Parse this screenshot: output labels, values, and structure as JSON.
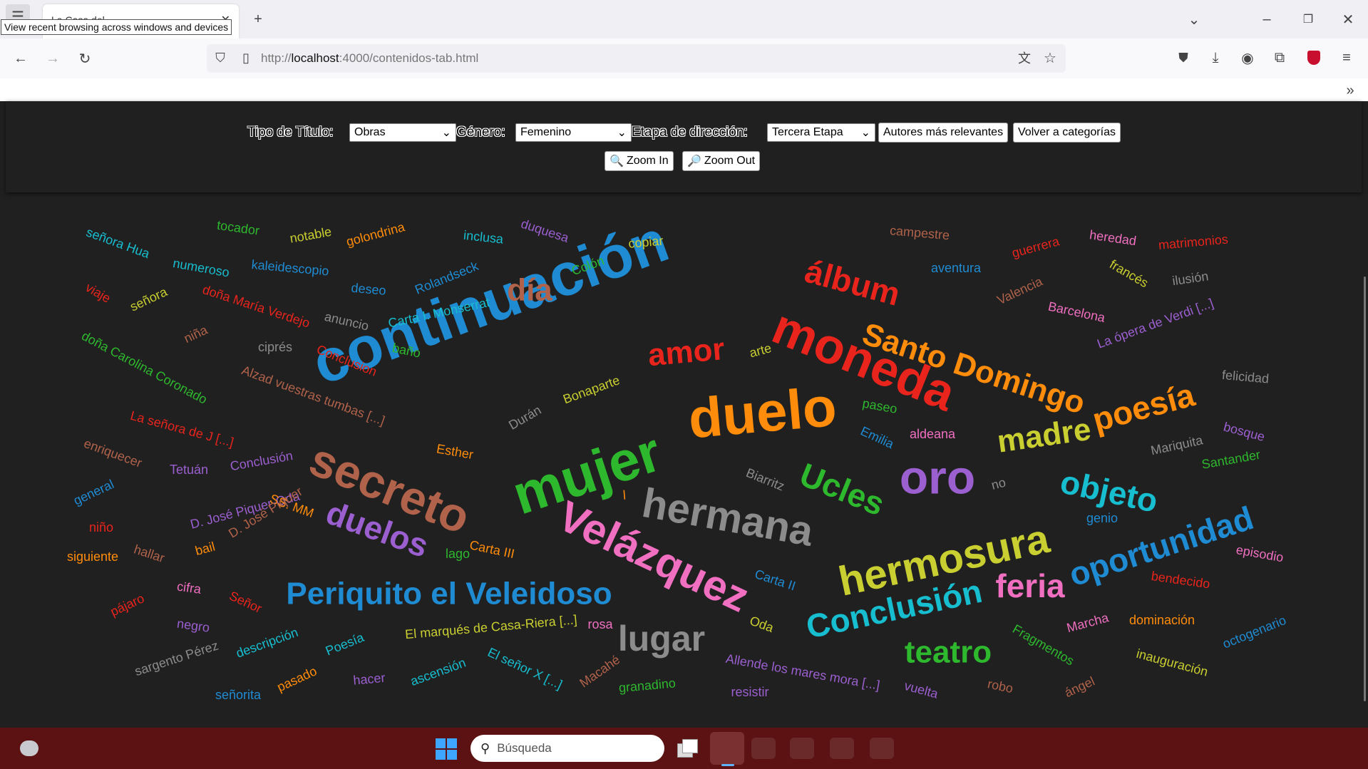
{
  "browser": {
    "tooltip": "View recent browsing across windows and devices",
    "url_prefix": "http://",
    "url_host": "localhost",
    "url_rest": ":4000/contenidos-tab.html",
    "tab_title": "La Casa del..."
  },
  "controls": {
    "tipo_label": "Tipo de Título:",
    "tipo_value": "Obras",
    "genero_label": "Género:",
    "genero_value": "Femenino",
    "etapa_label": "Etapa de dirección:",
    "etapa_value": "Tercera Etapa",
    "autores_button": "Autores más relevantes",
    "volver_button": "Volver a categorías",
    "zoom_in": "Zoom In",
    "zoom_out": "Zoom Out"
  },
  "taskbar": {
    "search_placeholder": "Búsqueda"
  },
  "word_cloud": [
    {
      "text": "continuación",
      "color": "#1f8bd2",
      "size": 84
    },
    {
      "text": "moneda",
      "color": "#e8241c",
      "size": 70
    },
    {
      "text": "duelo",
      "color": "#ff8c0a",
      "size": 78
    },
    {
      "text": "mujer",
      "color": "#2eb82e",
      "size": 78
    },
    {
      "text": "secreto",
      "color": "#b0624a",
      "size": 66
    },
    {
      "text": "Velázquez",
      "color": "#f06fc0",
      "size": 60
    },
    {
      "text": "hermana",
      "color": "#8c8c8c",
      "size": 58
    },
    {
      "text": "hermosura",
      "color": "#c9cf30",
      "size": 58
    },
    {
      "text": "oro",
      "color": "#9b5fd0",
      "size": 66
    },
    {
      "text": "Santo Domingo",
      "color": "#ff8c0a",
      "size": 44
    },
    {
      "text": "álbum",
      "color": "#e8241c",
      "size": 46
    },
    {
      "text": "amor",
      "color": "#e8241c",
      "size": 44
    },
    {
      "text": "día",
      "color": "#b0624a",
      "size": 44
    },
    {
      "text": "madre",
      "color": "#c9cf30",
      "size": 44
    },
    {
      "text": "poesía",
      "color": "#ff8c0a",
      "size": 46
    },
    {
      "text": "objeto",
      "color": "#17becf",
      "size": 46
    },
    {
      "text": "oportunidad",
      "color": "#1f8bd2",
      "size": 46
    },
    {
      "text": "Ucles",
      "color": "#2eb82e",
      "size": 46
    },
    {
      "text": "duelos",
      "color": "#9b5fd0",
      "size": 46
    },
    {
      "text": "Periquito el Veleidoso",
      "color": "#1f8bd2",
      "size": 44
    },
    {
      "text": "Conclusión",
      "color": "#17becf",
      "size": 46
    },
    {
      "text": "feria",
      "color": "#f06fc0",
      "size": 46
    },
    {
      "text": "teatro",
      "color": "#2eb82e",
      "size": 44
    },
    {
      "text": "lugar",
      "color": "#8c8c8c",
      "size": 50
    },
    {
      "text": "señora Hua",
      "color": "#17becf",
      "size": 18
    },
    {
      "text": "tocador",
      "color": "#2eb82e",
      "size": 18
    },
    {
      "text": "notable",
      "color": "#c9cf30",
      "size": 18
    },
    {
      "text": "golondrina",
      "color": "#ff8c0a",
      "size": 18
    },
    {
      "text": "inclusa",
      "color": "#17becf",
      "size": 18
    },
    {
      "text": "duquesa",
      "color": "#9b5fd0",
      "size": 18
    },
    {
      "text": "copiar",
      "color": "#c9cf30",
      "size": 18
    },
    {
      "text": "campestre",
      "color": "#b0624a",
      "size": 18
    },
    {
      "text": "heredad",
      "color": "#f06fc0",
      "size": 18
    },
    {
      "text": "matrimonios",
      "color": "#e8241c",
      "size": 18
    },
    {
      "text": "guerrera",
      "color": "#e8241c",
      "size": 18
    },
    {
      "text": "numeroso",
      "color": "#17becf",
      "size": 18
    },
    {
      "text": "kaleidescopio",
      "color": "#1f8bd2",
      "size": 18
    },
    {
      "text": "Colón",
      "color": "#2eb82e",
      "size": 18
    },
    {
      "text": "Rolandseck",
      "color": "#1f8bd2",
      "size": 18
    },
    {
      "text": "aventura",
      "color": "#1f8bd2",
      "size": 18
    },
    {
      "text": "francés",
      "color": "#c9cf30",
      "size": 18
    },
    {
      "text": "ilusión",
      "color": "#8c8c8c",
      "size": 18
    },
    {
      "text": "Valencia",
      "color": "#b0624a",
      "size": 18
    },
    {
      "text": "viaje",
      "color": "#e8241c",
      "size": 18
    },
    {
      "text": "señora",
      "color": "#c9cf30",
      "size": 18
    },
    {
      "text": "deseo",
      "color": "#1f8bd2",
      "size": 18
    },
    {
      "text": "doña María Verdejo",
      "color": "#e8241c",
      "size": 18
    },
    {
      "text": "anuncio",
      "color": "#8c8c8c",
      "size": 18
    },
    {
      "text": "Carta I. Monserrat",
      "color": "#17becf",
      "size": 18
    },
    {
      "text": "Barcelona",
      "color": "#f06fc0",
      "size": 18
    },
    {
      "text": "La ópera de Verdi [...]",
      "color": "#9b5fd0",
      "size": 18
    },
    {
      "text": "doña Carolina Coronado",
      "color": "#2eb82e",
      "size": 18
    },
    {
      "text": "niña",
      "color": "#b0624a",
      "size": 18
    },
    {
      "text": "ciprés",
      "color": "#8c8c8c",
      "size": 18
    },
    {
      "text": "Conclusion",
      "color": "#e8241c",
      "size": 18
    },
    {
      "text": "baño",
      "color": "#2eb82e",
      "size": 18
    },
    {
      "text": "arte",
      "color": "#c9cf30",
      "size": 18
    },
    {
      "text": "felicidad",
      "color": "#8c8c8c",
      "size": 18
    },
    {
      "text": "Alzad vuestras tumbas [...]",
      "color": "#b0624a",
      "size": 18
    },
    {
      "text": "Bonaparte",
      "color": "#c9cf30",
      "size": 18
    },
    {
      "text": "paseo",
      "color": "#2eb82e",
      "size": 18
    },
    {
      "text": "Emilia",
      "color": "#1f8bd2",
      "size": 18
    },
    {
      "text": "aldeana",
      "color": "#f06fc0",
      "size": 18
    },
    {
      "text": "bosque",
      "color": "#9b5fd0",
      "size": 18
    },
    {
      "text": "La señora de J [...]",
      "color": "#e8241c",
      "size": 18
    },
    {
      "text": "Durán",
      "color": "#8c8c8c",
      "size": 18
    },
    {
      "text": "Mariquita",
      "color": "#8c8c8c",
      "size": 18
    },
    {
      "text": "enriquecer",
      "color": "#b0624a",
      "size": 18
    },
    {
      "text": "Esther",
      "color": "#ff8c0a",
      "size": 18
    },
    {
      "text": "Santander",
      "color": "#2eb82e",
      "size": 18
    },
    {
      "text": "Tetuán",
      "color": "#9b5fd0",
      "size": 18
    },
    {
      "text": "Conclusión",
      "color": "#9b5fd0",
      "size": 18
    },
    {
      "text": "Biarritz",
      "color": "#8c8c8c",
      "size": 18
    },
    {
      "text": "no",
      "color": "#8c8c8c",
      "size": 18
    },
    {
      "text": "general",
      "color": "#1f8bd2",
      "size": 18
    },
    {
      "text": "D. José Piquer-Oda",
      "color": "#9b5fd0",
      "size": 18
    },
    {
      "text": "SS. MM",
      "color": "#ff8c0a",
      "size": 18
    },
    {
      "text": "l",
      "color": "#ff8c0a",
      "size": 18
    },
    {
      "text": "genio",
      "color": "#1f8bd2",
      "size": 18
    },
    {
      "text": "niño",
      "color": "#e8241c",
      "size": 18
    },
    {
      "text": "D. José Piquer",
      "color": "#b0624a",
      "size": 18
    },
    {
      "text": "siguiente",
      "color": "#ff8c0a",
      "size": 18
    },
    {
      "text": "hallar",
      "color": "#b0624a",
      "size": 18
    },
    {
      "text": "bail",
      "color": "#ff8c0a",
      "size": 18
    },
    {
      "text": "lago",
      "color": "#2eb82e",
      "size": 18
    },
    {
      "text": "Carta III",
      "color": "#ff8c0a",
      "size": 18
    },
    {
      "text": "episodio",
      "color": "#f06fc0",
      "size": 18
    },
    {
      "text": "cifra",
      "color": "#f06fc0",
      "size": 18
    },
    {
      "text": "Carta II",
      "color": "#1f8bd2",
      "size": 18
    },
    {
      "text": "bendecido",
      "color": "#e8241c",
      "size": 18
    },
    {
      "text": "pájaro",
      "color": "#e8241c",
      "size": 18
    },
    {
      "text": "Señor",
      "color": "#e8241c",
      "size": 18
    },
    {
      "text": "negro",
      "color": "#9b5fd0",
      "size": 18
    },
    {
      "text": "El marqués de Casa-Riera [...]",
      "color": "#c9cf30",
      "size": 18
    },
    {
      "text": "rosa",
      "color": "#f06fc0",
      "size": 18
    },
    {
      "text": "Oda",
      "color": "#c9cf30",
      "size": 18
    },
    {
      "text": "Marcha",
      "color": "#f06fc0",
      "size": 18
    },
    {
      "text": "dominación",
      "color": "#ff8c0a",
      "size": 18
    },
    {
      "text": "octogenario",
      "color": "#1f8bd2",
      "size": 18
    },
    {
      "text": "descripción",
      "color": "#17becf",
      "size": 18
    },
    {
      "text": "Poesía",
      "color": "#17becf",
      "size": 18
    },
    {
      "text": "Fragmentos",
      "color": "#2eb82e",
      "size": 18
    },
    {
      "text": "sargento Pérez",
      "color": "#8c8c8c",
      "size": 18
    },
    {
      "text": "El señor X [...]",
      "color": "#17becf",
      "size": 18
    },
    {
      "text": "Allende los mares mora [...]",
      "color": "#9b5fd0",
      "size": 18
    },
    {
      "text": "inauguración",
      "color": "#c9cf30",
      "size": 18
    },
    {
      "text": "pasado",
      "color": "#ff8c0a",
      "size": 18
    },
    {
      "text": "hacer",
      "color": "#9b5fd0",
      "size": 18
    },
    {
      "text": "ascensión",
      "color": "#17becf",
      "size": 18
    },
    {
      "text": "Macahé",
      "color": "#b0624a",
      "size": 18
    },
    {
      "text": "granadino",
      "color": "#2eb82e",
      "size": 18
    },
    {
      "text": "robo",
      "color": "#b0624a",
      "size": 18
    },
    {
      "text": "vuelta",
      "color": "#9b5fd0",
      "size": 18
    },
    {
      "text": "ángel",
      "color": "#b0624a",
      "size": 18
    },
    {
      "text": "señorita",
      "color": "#1f8bd2",
      "size": 18
    },
    {
      "text": "resistir",
      "color": "#9b5fd0",
      "size": 18
    }
  ]
}
